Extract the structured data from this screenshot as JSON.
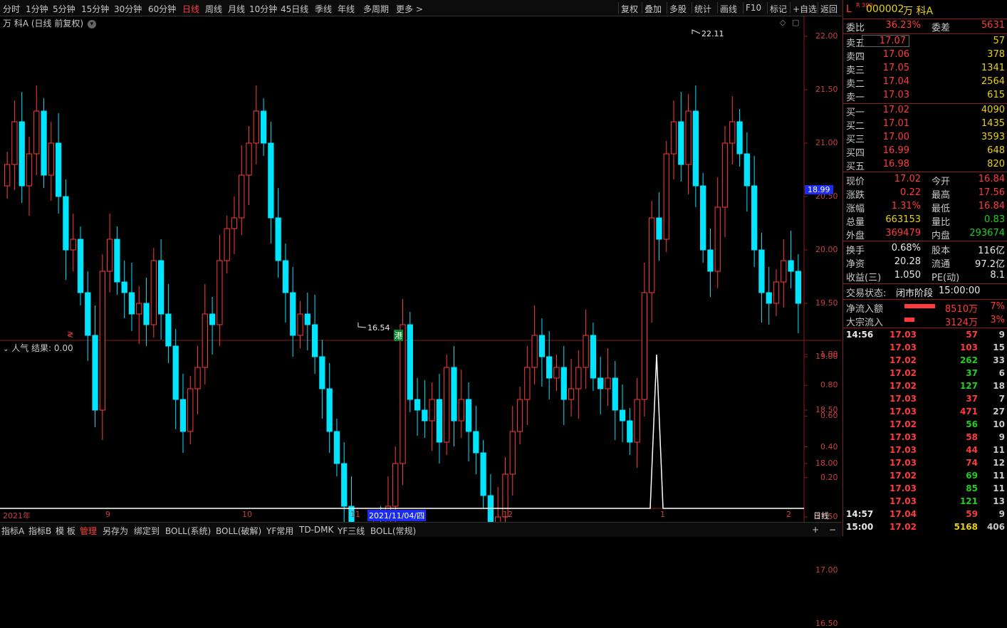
{
  "toolbar": {
    "periods": [
      "分时",
      "1分钟",
      "5分钟",
      "15分钟",
      "30分钟",
      "60分钟",
      "日线",
      "周线",
      "月线",
      "10分钟",
      "45日线",
      "季线",
      "年线",
      "多周期",
      "更多 >"
    ],
    "active_period": "日线",
    "right_buttons": [
      "复权",
      "叠加",
      "多股",
      "统计",
      "画线",
      "F10",
      "标记",
      "+自选",
      "返回"
    ]
  },
  "main_chart": {
    "title": "万 科A (日线 前复权)",
    "y_ticks": [
      "22.00",
      "21.50",
      "21.00",
      "20.50",
      "20.00",
      "19.50",
      "19.00",
      "18.50",
      "18.00",
      "17.50",
      "17.00",
      "16.50"
    ],
    "current_price_tag": "18.99",
    "high_label": "22.11",
    "low_label": "16.54",
    "hk_marker": "港"
  },
  "indicator": {
    "title": "人气 结果: 0.00",
    "y_ticks": [
      "1.00",
      "0.80",
      "0.60",
      "0.40",
      "0.20"
    ]
  },
  "date_axis": {
    "labels": [
      "2021年",
      "9",
      "10",
      "11",
      "2021/11/04/四",
      "12",
      "1",
      "2"
    ],
    "period_label": "日线"
  },
  "bottom_tabs": [
    "指标A",
    "指标B",
    "模 板",
    "管理",
    "另存为",
    "绑定到",
    "BOLL(系统)",
    "BOLL(破解)",
    "YF常用",
    "TD-DMK",
    "YF三线",
    "BOLL(常规)"
  ],
  "bottom_active": "管理",
  "bottom_right": [
    "+",
    "−"
  ],
  "quote": {
    "code_prefix": "L",
    "code_badge": "R 300",
    "code": "000002",
    "name": "万 科A",
    "webi_label": "委比",
    "webi": "36.23%",
    "wecha_label": "委差",
    "wecha": "5631",
    "asks": [
      {
        "label": "卖五",
        "price": "17.07",
        "vol": "57"
      },
      {
        "label": "卖四",
        "price": "17.06",
        "vol": "378"
      },
      {
        "label": "卖三",
        "price": "17.05",
        "vol": "1341"
      },
      {
        "label": "卖二",
        "price": "17.04",
        "vol": "2564"
      },
      {
        "label": "卖一",
        "price": "17.03",
        "vol": "615"
      }
    ],
    "bids": [
      {
        "label": "买一",
        "price": "17.02",
        "vol": "4090"
      },
      {
        "label": "买二",
        "price": "17.01",
        "vol": "1435"
      },
      {
        "label": "买三",
        "price": "17.00",
        "vol": "3593"
      },
      {
        "label": "买四",
        "price": "16.99",
        "vol": "648"
      },
      {
        "label": "买五",
        "price": "16.98",
        "vol": "820"
      }
    ],
    "stats": [
      {
        "l1": "现价",
        "v1": "17.02",
        "c1": "red",
        "l2": "今开",
        "v2": "16.84",
        "c2": "red"
      },
      {
        "l1": "涨跌",
        "v1": "0.22",
        "c1": "red",
        "l2": "最高",
        "v2": "17.56",
        "c2": "red"
      },
      {
        "l1": "涨幅",
        "v1": "1.31%",
        "c1": "red",
        "l2": "最低",
        "v2": "16.84",
        "c2": "red"
      },
      {
        "l1": "总量",
        "v1": "663153",
        "c1": "yel",
        "l2": "量比",
        "v2": "0.83",
        "c2": "grn"
      },
      {
        "l1": "外盘",
        "v1": "369479",
        "c1": "red",
        "l2": "内盘",
        "v2": "293674",
        "c2": "grn"
      }
    ],
    "stats2": [
      {
        "l1": "换手",
        "v1": "0.68%",
        "l2": "股本",
        "v2": "116亿"
      },
      {
        "l1": "净资",
        "v1": "20.28",
        "l2": "流通",
        "v2": "97.2亿"
      },
      {
        "l1": "收益(三)",
        "v1": "1.050",
        "l2": "PE(动)",
        "v2": "8.1"
      }
    ],
    "trade_status_label": "交易状态:",
    "trade_status": "闭市阶段",
    "trade_time": "15:00:00",
    "flows": [
      {
        "label": "净流入额",
        "value": "8510万",
        "pct": "7%",
        "bar": 0.9
      },
      {
        "label": "大宗流入",
        "value": "3124万",
        "pct": "3%",
        "bar": 0.3
      }
    ],
    "ticks": [
      {
        "time": "14:56",
        "price": "17.03",
        "vol": "57",
        "vc": "red",
        "n": "9"
      },
      {
        "time": "",
        "price": "17.03",
        "vol": "103",
        "vc": "red",
        "n": "15"
      },
      {
        "time": "",
        "price": "17.02",
        "vol": "262",
        "vc": "grn",
        "n": "33"
      },
      {
        "time": "",
        "price": "17.02",
        "vol": "37",
        "vc": "grn",
        "n": "6"
      },
      {
        "time": "",
        "price": "17.02",
        "vol": "127",
        "vc": "grn",
        "n": "18"
      },
      {
        "time": "",
        "price": "17.03",
        "vol": "37",
        "vc": "red",
        "n": "7"
      },
      {
        "time": "",
        "price": "17.03",
        "vol": "471",
        "vc": "red",
        "n": "27"
      },
      {
        "time": "",
        "price": "17.02",
        "vol": "56",
        "vc": "grn",
        "n": "10"
      },
      {
        "time": "",
        "price": "17.03",
        "vol": "58",
        "vc": "red",
        "n": "9"
      },
      {
        "time": "",
        "price": "17.03",
        "vol": "44",
        "vc": "red",
        "n": "11"
      },
      {
        "time": "",
        "price": "17.03",
        "vol": "74",
        "vc": "red",
        "n": "12"
      },
      {
        "time": "",
        "price": "17.02",
        "vol": "69",
        "vc": "grn",
        "n": "11"
      },
      {
        "time": "",
        "price": "17.03",
        "vol": "85",
        "vc": "grn",
        "n": "11"
      },
      {
        "time": "",
        "price": "17.03",
        "vol": "121",
        "vc": "grn",
        "n": "13"
      },
      {
        "time": "14:57",
        "price": "17.04",
        "vol": "59",
        "vc": "red",
        "n": "9"
      },
      {
        "time": "15:00",
        "price": "17.02",
        "vol": "5168",
        "vc": "yel",
        "n": "406"
      }
    ]
  },
  "colors": {
    "up": "#ff3b3b",
    "down": "#00e5ff",
    "axis": "#8b1a1a",
    "bg": "#000000"
  }
}
